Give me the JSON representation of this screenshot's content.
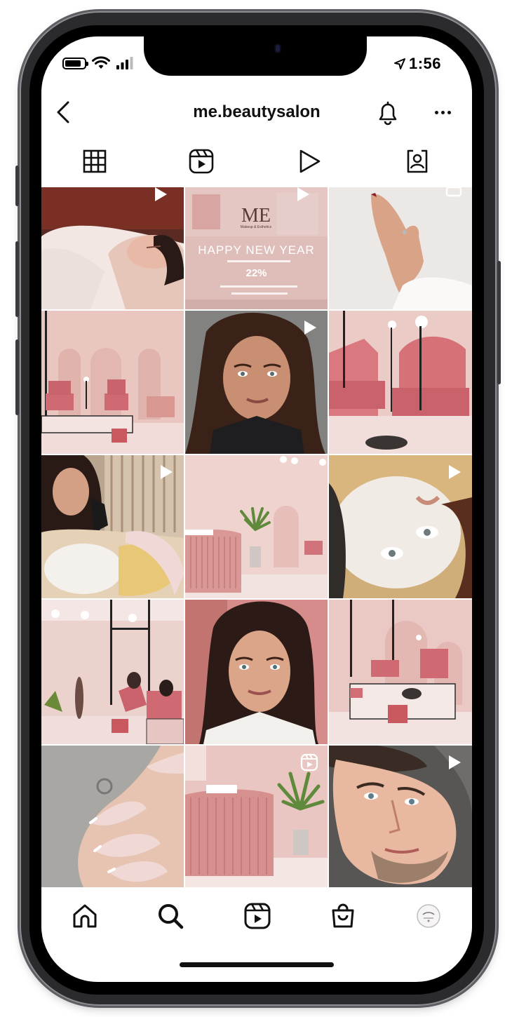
{
  "status_bar": {
    "time": "1:56",
    "battery_level": 0.85,
    "icons": [
      "battery-icon",
      "wifi-icon",
      "cellular-signal-icon",
      "location-arrow-icon"
    ]
  },
  "header": {
    "username": "me.beautysalon",
    "icons": [
      "back-arrow-icon",
      "bell-icon",
      "more-icon"
    ]
  },
  "tabs": [
    {
      "name": "grid",
      "icon": "grid-icon",
      "selected": true
    },
    {
      "name": "reels",
      "icon": "reels-icon",
      "selected": false
    },
    {
      "name": "videos",
      "icon": "play-icon",
      "selected": false
    },
    {
      "name": "tagged",
      "icon": "tagged-person-icon",
      "selected": false
    }
  ],
  "posts": [
    {
      "subject": "woman relaxing on fluffy pink blanket",
      "badge": "play-icon"
    },
    {
      "subject": "new year promotion graphic",
      "badge": "play-icon",
      "overlay": {
        "logo": "ME",
        "logo_caption": "Makeup & Esthetics",
        "headline": "HAPPY NEW YEAR",
        "discount": "22%"
      }
    },
    {
      "subject": "manicured hand with ring",
      "badge": "carousel-icon"
    },
    {
      "subject": "pink salon interior with chairs",
      "badge": ""
    },
    {
      "subject": "portrait of woman with dark hair",
      "badge": "play-icon"
    },
    {
      "subject": "pink velvet armchairs",
      "badge": ""
    },
    {
      "subject": "beautician with client in face mask",
      "badge": "play-icon"
    },
    {
      "subject": "reception desk with palm plant",
      "badge": ""
    },
    {
      "subject": "client with white clay face mask",
      "badge": "play-icon"
    },
    {
      "subject": "salon room with staff working",
      "badge": ""
    },
    {
      "subject": "portrait of smiling woman",
      "badge": ""
    },
    {
      "subject": "pedicure station with pink chairs",
      "badge": ""
    },
    {
      "subject": "french manicure nails",
      "badge": ""
    },
    {
      "subject": "reception desk close-up",
      "badge": "reels-icon"
    },
    {
      "subject": "man after facial treatment",
      "badge": "play-icon"
    }
  ],
  "bottom_nav": [
    {
      "name": "home",
      "icon": "home-icon"
    },
    {
      "name": "search",
      "icon": "search-icon"
    },
    {
      "name": "reels",
      "icon": "reels-icon"
    },
    {
      "name": "shop",
      "icon": "shopping-bag-icon"
    },
    {
      "name": "profile",
      "icon": "profile-avatar-icon"
    }
  ],
  "colors": {
    "salon_pink": "#e9c2be",
    "velvet_rose": "#d97a80",
    "text": "#111111"
  }
}
